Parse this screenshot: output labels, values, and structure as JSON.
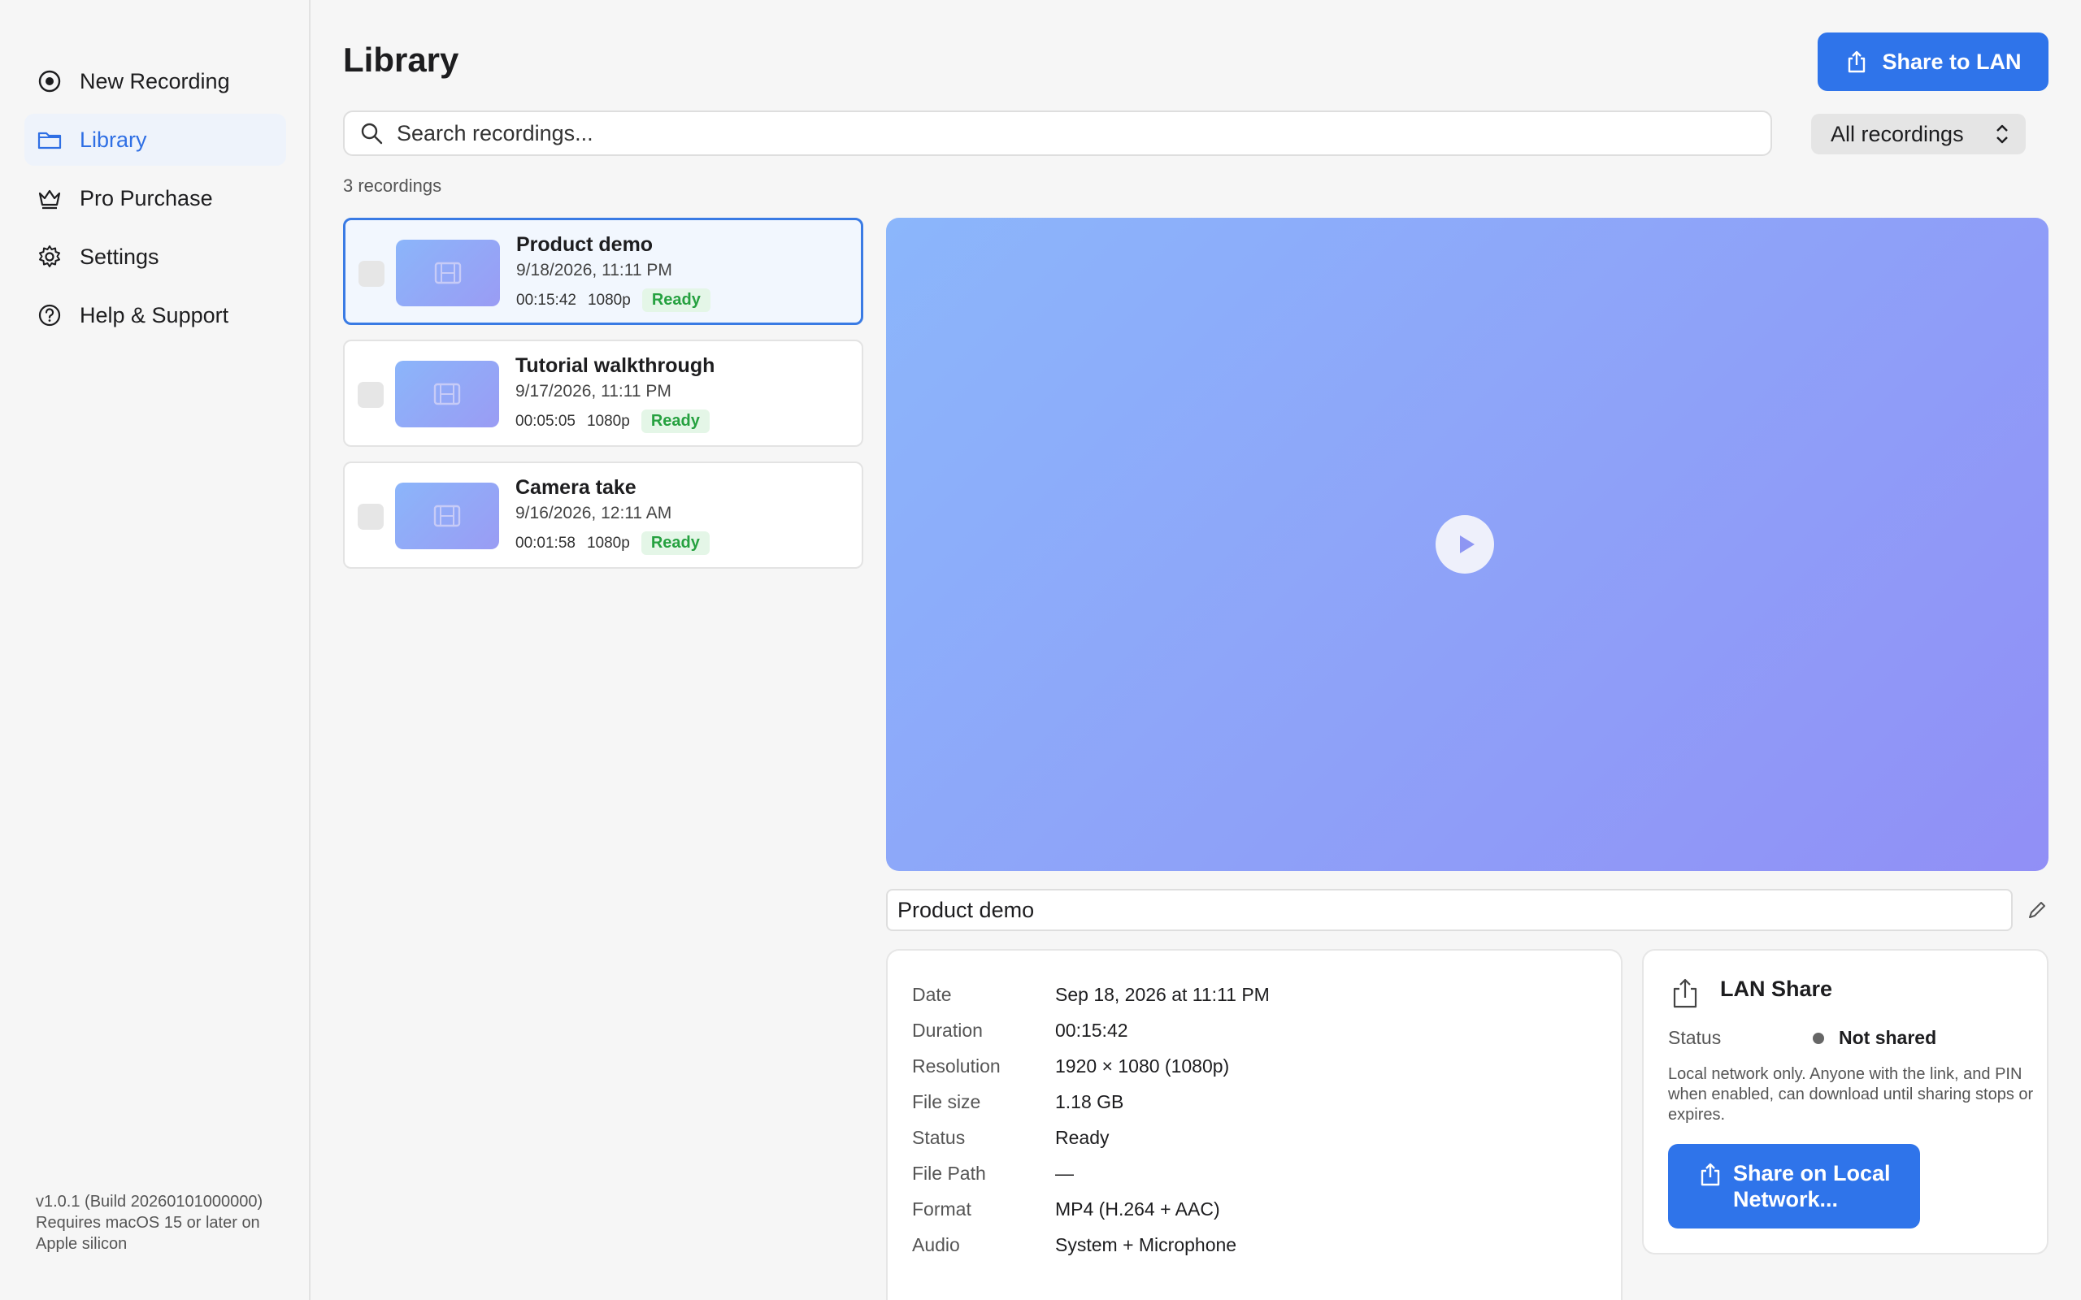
{
  "sidebar": {
    "items": [
      {
        "label": "New Recording",
        "icon": "record-icon"
      },
      {
        "label": "Library",
        "icon": "folder-icon",
        "active": true
      },
      {
        "label": "Pro Purchase",
        "icon": "crown-icon"
      },
      {
        "label": "Settings",
        "icon": "gear-icon"
      },
      {
        "label": "Help & Support",
        "icon": "question-icon"
      }
    ],
    "version_line1": "v1.0.1 (Build 20260101000000)",
    "version_line2": "Requires macOS 15 or later on Apple silicon"
  },
  "header": {
    "title": "Library",
    "share_button": "Share to LAN"
  },
  "search": {
    "placeholder": "Search recordings..."
  },
  "filter": {
    "selected": "All recordings"
  },
  "list": {
    "count": "3 recordings",
    "items": [
      {
        "title": "Product demo",
        "date": "9/18/2026, 11:11 PM",
        "duration": "00:15:42",
        "resolution": "1080p",
        "status": "Ready",
        "selected": true
      },
      {
        "title": "Tutorial walkthrough",
        "date": "9/17/2026, 11:11 PM",
        "duration": "00:05:05",
        "resolution": "1080p",
        "status": "Ready"
      },
      {
        "title": "Camera take",
        "date": "9/16/2026, 12:11 AM",
        "duration": "00:01:58",
        "resolution": "1080p",
        "status": "Ready"
      }
    ]
  },
  "detail": {
    "name": "Product demo",
    "rows": [
      {
        "label": "Date",
        "value": "Sep 18, 2026 at 11:11 PM"
      },
      {
        "label": "Duration",
        "value": "00:15:42"
      },
      {
        "label": "Resolution",
        "value": "1920 × 1080 (1080p)"
      },
      {
        "label": "File size",
        "value": "1.18 GB"
      },
      {
        "label": "Status",
        "value": "Ready"
      },
      {
        "label": "File Path",
        "value": "—"
      },
      {
        "label": "Format",
        "value": "MP4 (H.264 + AAC)"
      },
      {
        "label": "Audio",
        "value": "System + Microphone"
      }
    ]
  },
  "lan": {
    "title": "LAN Share",
    "status_label": "Status",
    "status_value": "Not shared",
    "description": "Local network only. Anyone with the link, and PIN when enabled, can download until sharing stops or expires.",
    "button": "Share on Local Network..."
  },
  "colors": {
    "accent": "#2f74ea",
    "ready_badge_bg": "#e4f6e7",
    "ready_badge_text": "#26a140"
  }
}
